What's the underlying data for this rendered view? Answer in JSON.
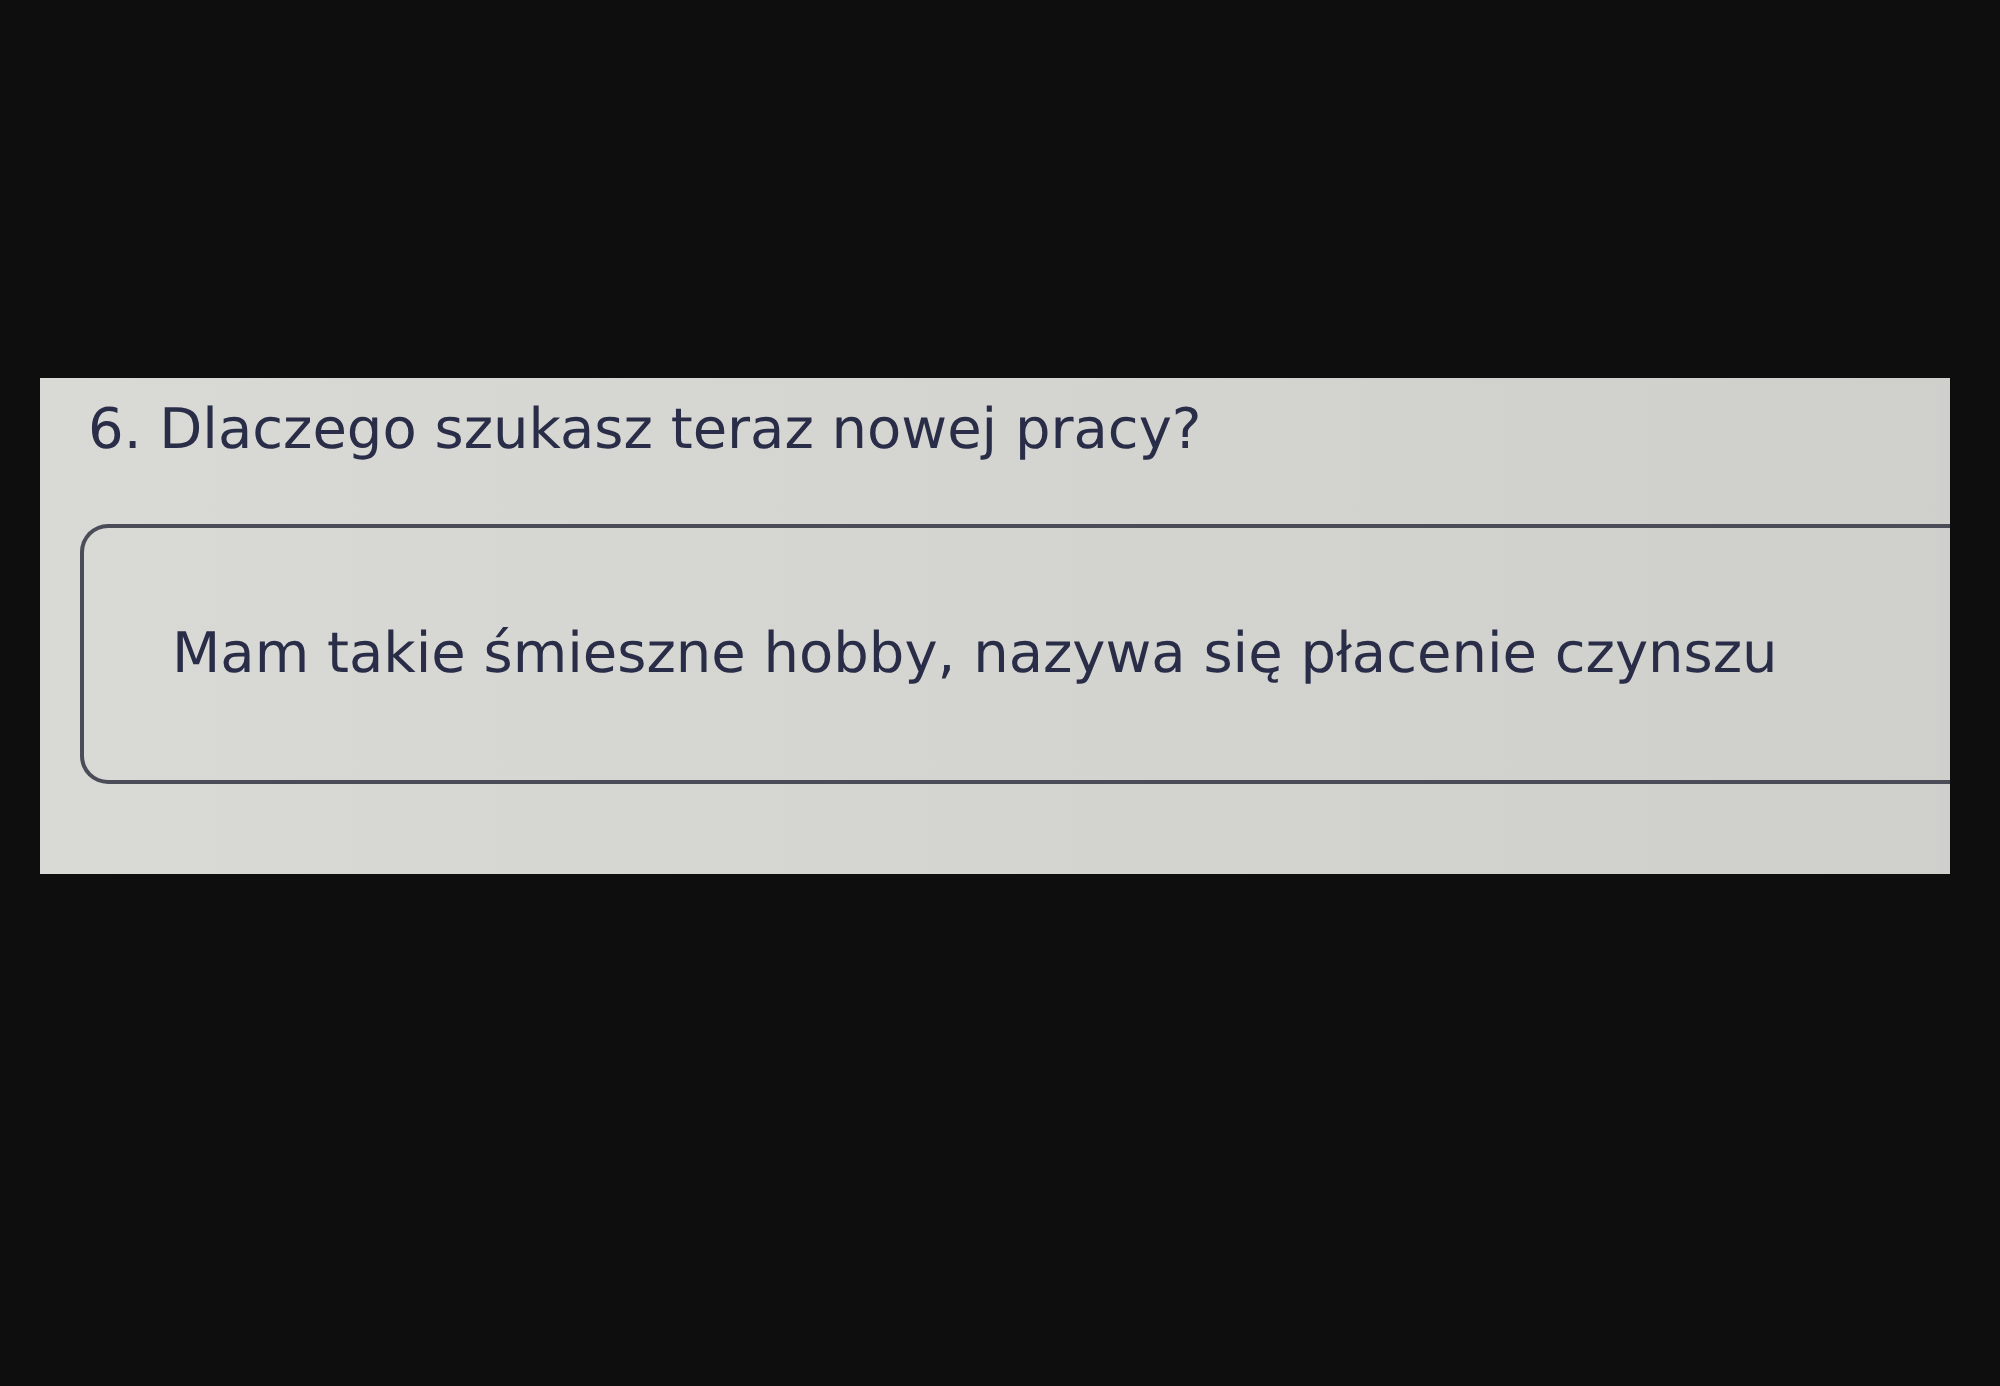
{
  "question": {
    "text": "6. Dlaczego szukasz teraz nowej pracy?"
  },
  "answer": {
    "value": "Mam takie śmieszne hobby, nazywa się płacenie czynszu"
  }
}
